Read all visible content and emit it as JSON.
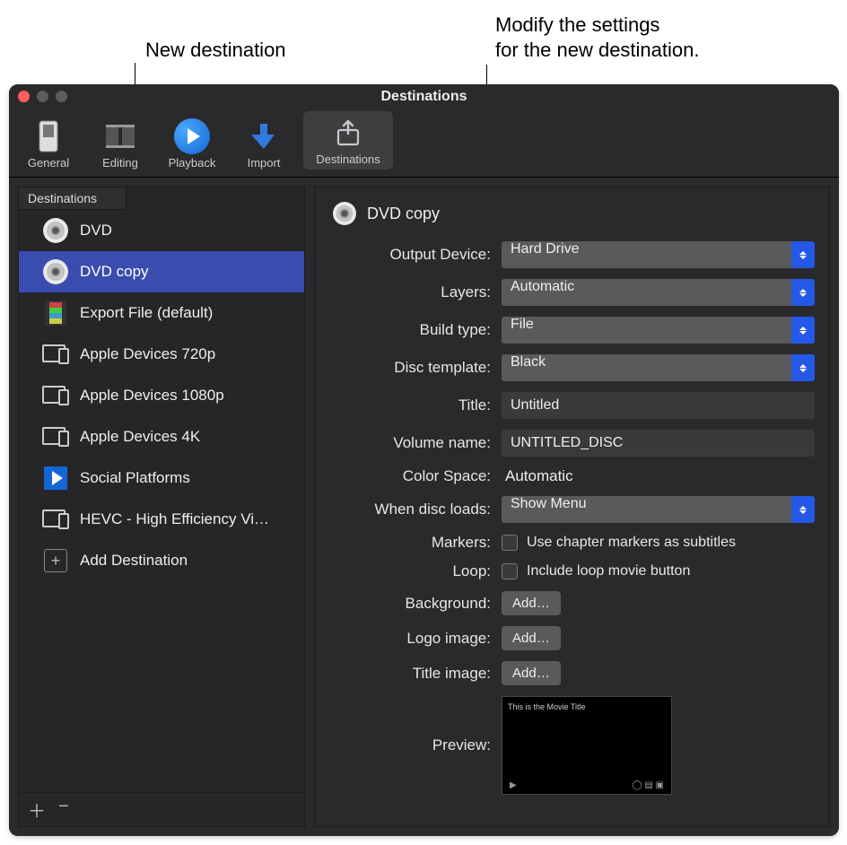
{
  "callouts": {
    "left": "New destination",
    "right": "Modify the settings\nfor the new destination."
  },
  "window": {
    "title": "Destinations"
  },
  "toolbar": {
    "items": [
      {
        "label": "General"
      },
      {
        "label": "Editing"
      },
      {
        "label": "Playback"
      },
      {
        "label": "Import"
      },
      {
        "label": "Destinations"
      }
    ]
  },
  "sidebar": {
    "header": "Destinations",
    "items": [
      {
        "label": "DVD",
        "icon": "disc"
      },
      {
        "label": "DVD copy",
        "icon": "disc",
        "selected": true
      },
      {
        "label": "Export File (default)",
        "icon": "film"
      },
      {
        "label": "Apple Devices 720p",
        "icon": "devices"
      },
      {
        "label": "Apple Devices 1080p",
        "icon": "devices"
      },
      {
        "label": "Apple Devices 4K",
        "icon": "devices"
      },
      {
        "label": "Social Platforms",
        "icon": "social"
      },
      {
        "label": "HEVC - High Efficiency Vi…",
        "icon": "devices"
      },
      {
        "label": "Add Destination",
        "icon": "plus"
      }
    ]
  },
  "detail": {
    "title": "DVD copy",
    "fields": {
      "output_device": {
        "label": "Output Device:",
        "value": "Hard Drive"
      },
      "layers": {
        "label": "Layers:",
        "value": "Automatic"
      },
      "build_type": {
        "label": "Build type:",
        "value": "File"
      },
      "disc_template": {
        "label": "Disc template:",
        "value": "Black"
      },
      "title": {
        "label": "Title:",
        "value": "Untitled"
      },
      "volume_name": {
        "label": "Volume name:",
        "value": "UNTITLED_DISC"
      },
      "color_space": {
        "label": "Color Space:",
        "value": "Automatic"
      },
      "disc_loads": {
        "label": "When disc loads:",
        "value": "Show Menu"
      },
      "markers": {
        "label": "Markers:",
        "value": "Use chapter markers as subtitles"
      },
      "loop": {
        "label": "Loop:",
        "value": "Include loop movie button"
      },
      "background": {
        "label": "Background:",
        "button": "Add…"
      },
      "logo_image": {
        "label": "Logo image:",
        "button": "Add…"
      },
      "title_image": {
        "label": "Title image:",
        "button": "Add…"
      },
      "preview": {
        "label": "Preview:",
        "caption": "This is the Movie Title"
      }
    }
  }
}
